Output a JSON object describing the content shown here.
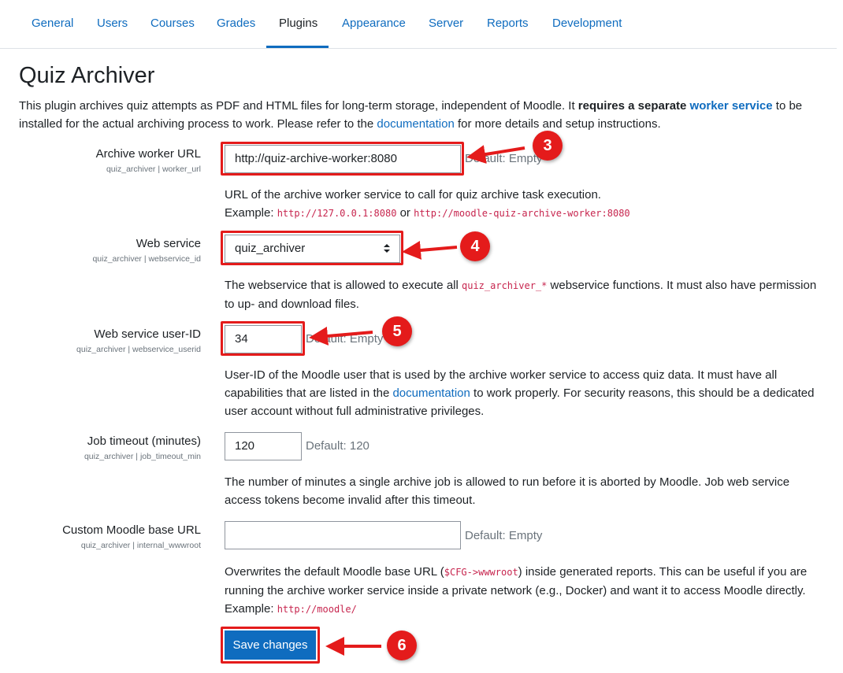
{
  "nav": {
    "tabs": [
      "General",
      "Users",
      "Courses",
      "Grades",
      "Plugins",
      "Appearance",
      "Server",
      "Reports",
      "Development"
    ],
    "active": "Plugins"
  },
  "page": {
    "title": "Quiz Archiver",
    "intro_1": "This plugin archives quiz attempts as PDF and HTML files for long-term storage, independent of Moodle. It ",
    "intro_bold": "requires a separate",
    "intro_link_worker": "worker service",
    "intro_2": " to be installed for the actual archiving process to work. Please refer to the ",
    "intro_link_doc": "documentation",
    "intro_3": " for more details and setup instructions."
  },
  "settings": {
    "worker_url": {
      "label": "Archive worker URL",
      "name": "quiz_archiver | worker_url",
      "value": "http://quiz-archive-worker:8080",
      "default": "Default: Empty",
      "desc_1": "URL of the archive worker service to call for quiz archive task execution.",
      "desc_example": "Example: ",
      "code_1": "http://127.0.0.1:8080",
      "desc_or": " or ",
      "code_2": "http://moodle-quiz-archive-worker:8080"
    },
    "webservice": {
      "label": "Web service",
      "name": "quiz_archiver | webservice_id",
      "selected": "quiz_archiver",
      "desc_1": "The webservice that is allowed to execute all ",
      "code": "quiz_archiver_*",
      "desc_2": " webservice functions. It must also have permission to up- and download files."
    },
    "userid": {
      "label": "Web service user-ID",
      "name": "quiz_archiver | webservice_userid",
      "value": "34",
      "default": "Default: Empty",
      "desc_1": "User-ID of the Moodle user that is used by the archive worker service to access quiz data. It must have all capabilities that are listed in the ",
      "desc_link": "documentation",
      "desc_2": " to work properly. For security reasons, this should be a dedicated user account without full administrative privileges."
    },
    "timeout": {
      "label": "Job timeout (minutes)",
      "name": "quiz_archiver | job_timeout_min",
      "value": "120",
      "default": "Default: 120",
      "desc": "The number of minutes a single archive job is allowed to run before it is aborted by Moodle. Job web service access tokens become invalid after this timeout."
    },
    "wwwroot": {
      "label": "Custom Moodle base URL",
      "name": "quiz_archiver | internal_wwwroot",
      "value": "",
      "default": "Default: Empty",
      "desc_1": "Overwrites the default Moodle base URL (",
      "code": "$CFG->wwwroot",
      "desc_2": ") inside generated reports. This can be useful if you are running the archive worker service inside a private network (e.g., Docker) and want it to access Moodle directly.",
      "desc_example": "Example: ",
      "code_example": "http://moodle/"
    }
  },
  "save_button": "Save changes",
  "annotations": {
    "badges": [
      "3",
      "4",
      "5",
      "6"
    ],
    "color": "#e41b1b"
  },
  "colors": {
    "link": "#0f6cbf",
    "code": "#c7254e",
    "muted": "#6a737b"
  }
}
